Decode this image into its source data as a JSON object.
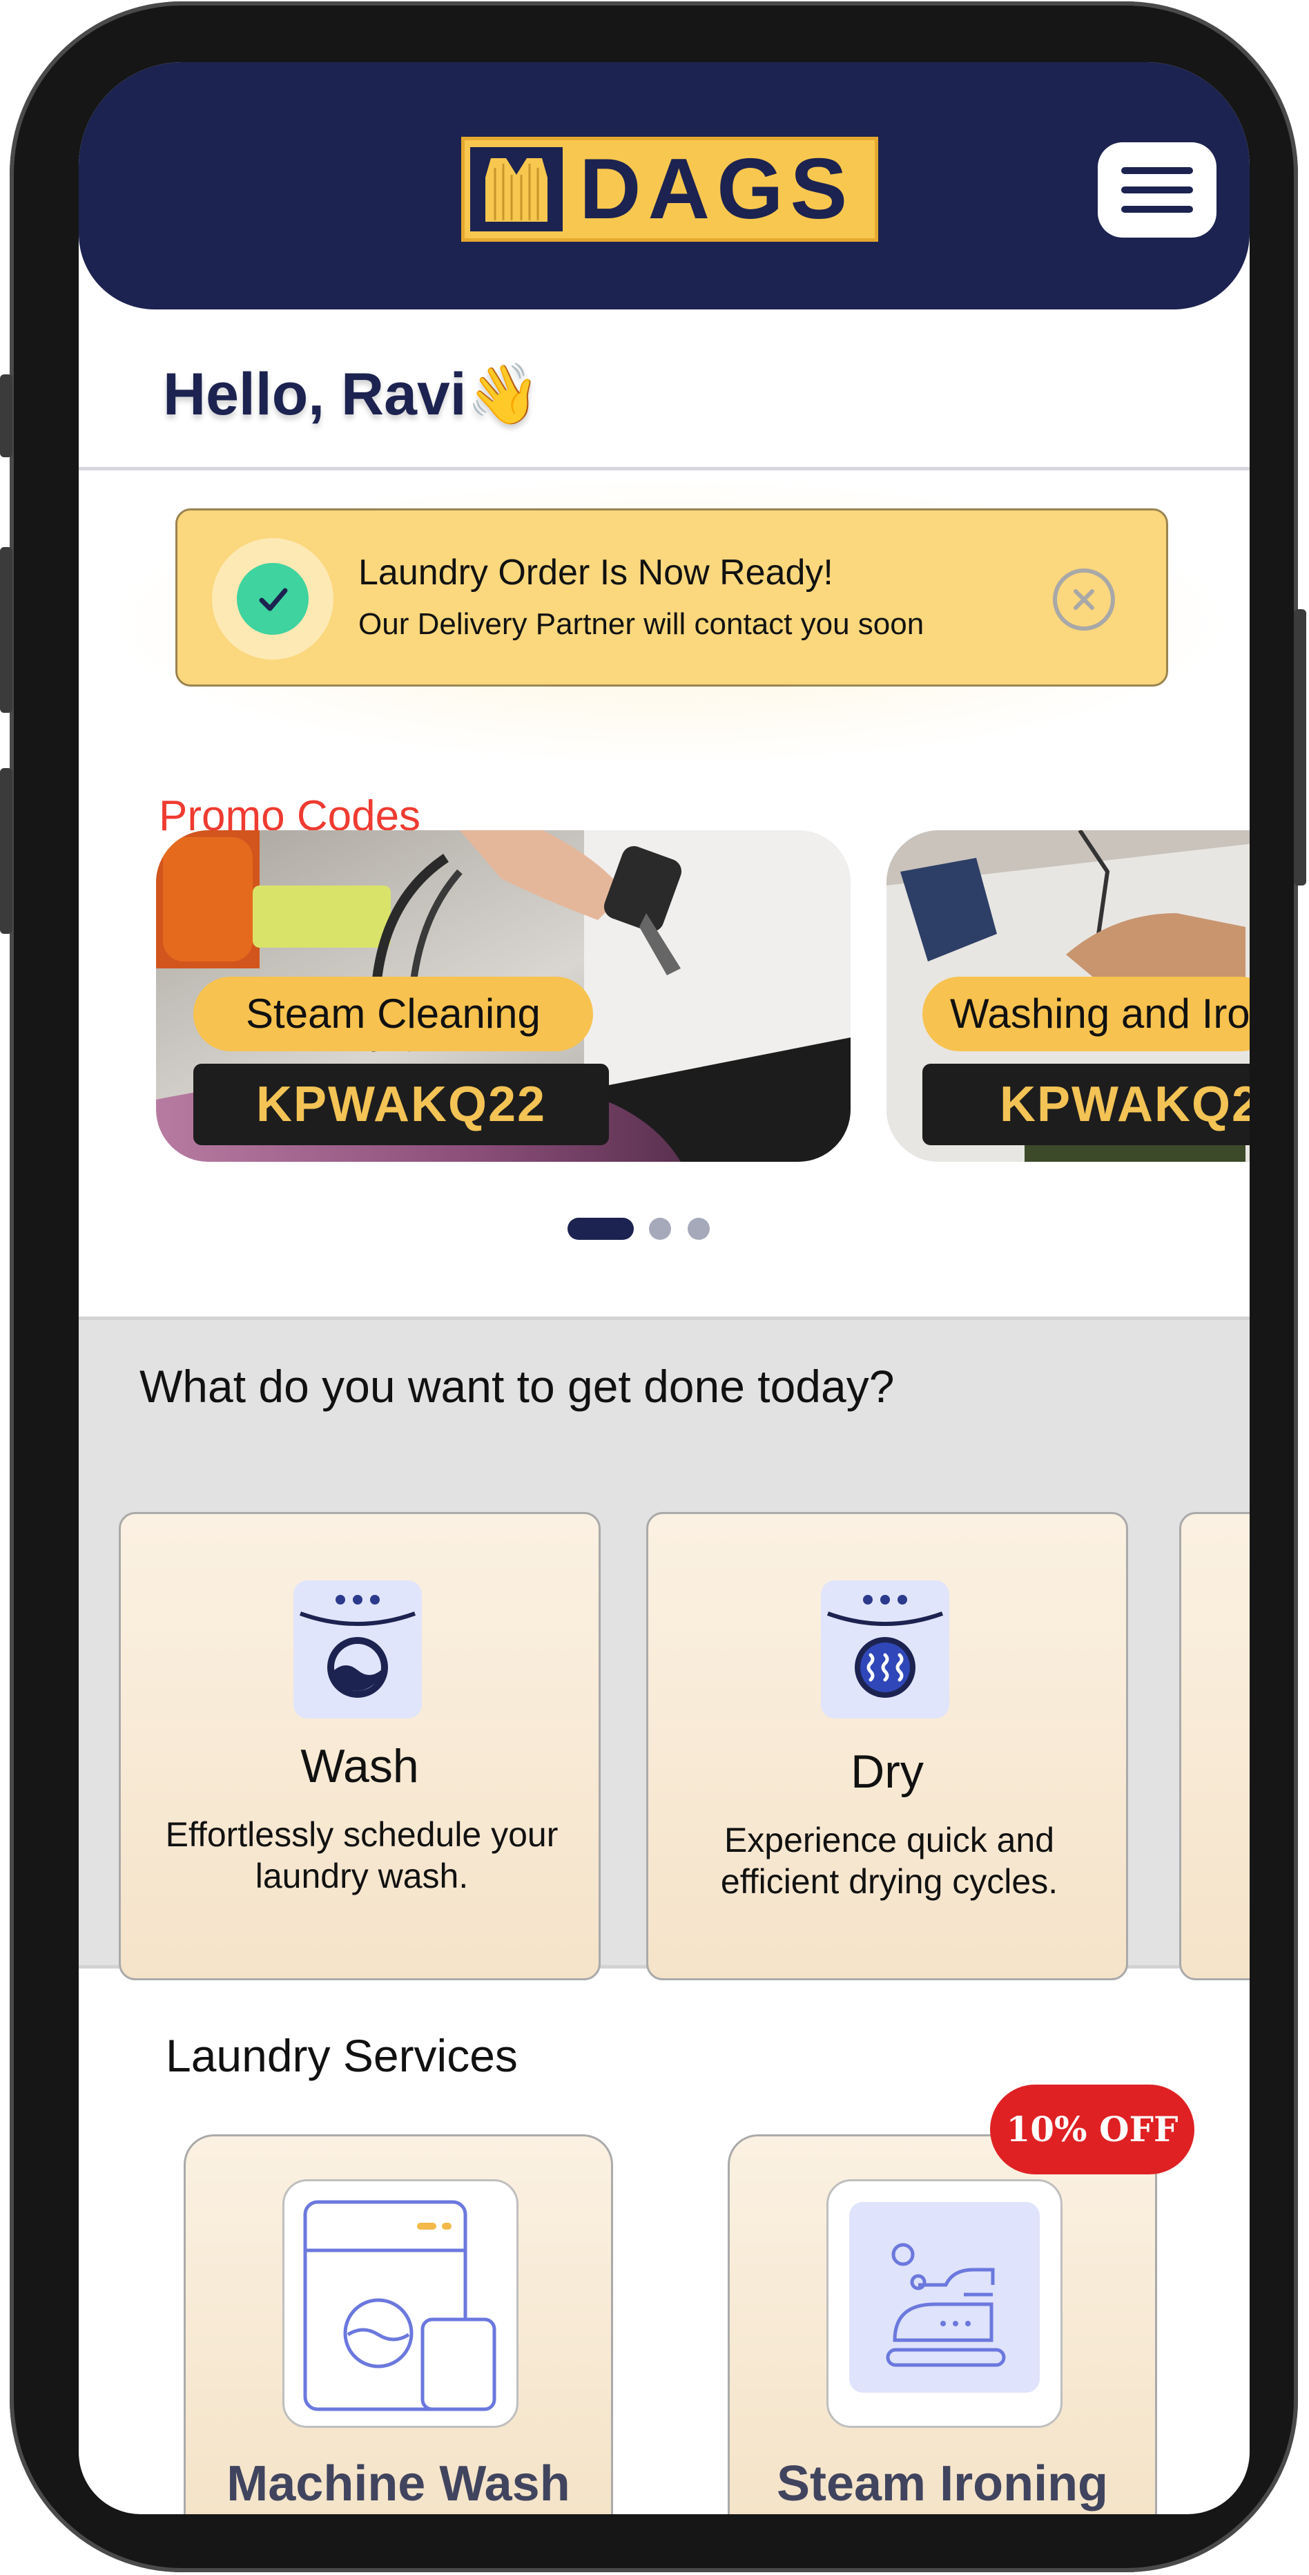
{
  "header": {
    "logo_text": "DAGS",
    "menu_icon": "hamburger-menu-icon"
  },
  "greeting": {
    "text": "Hello, Ravi",
    "emoji": "👋"
  },
  "notification": {
    "title": "Laundry Order Is Now Ready!",
    "subtitle": "Our Delivery Partner will contact you soon",
    "status_icon": "check-icon",
    "close_icon": "close-circle-icon"
  },
  "promo": {
    "section_title": "Promo Codes",
    "cards": [
      {
        "label": "Steam Cleaning",
        "code": "KPWAKQ22"
      },
      {
        "label": "Washing and Iro",
        "code": "KPWAKQ2"
      }
    ],
    "carousel_pages": 3,
    "active_page": 1
  },
  "services_question": {
    "title": "What do you want to get done today?",
    "items": [
      {
        "title": "Wash",
        "desc": "Effortlessly schedule your laundry wash.",
        "icon": "washing-machine-icon"
      },
      {
        "title": "Dry",
        "desc": "Experience quick and efficient drying cycles.",
        "icon": "dryer-icon"
      }
    ]
  },
  "laundry_services": {
    "title": "Laundry Services",
    "items": [
      {
        "name": "Machine Wash",
        "icon": "machine-wash-icon"
      },
      {
        "name": "Steam Ironing",
        "icon": "steam-iron-icon",
        "badge": "10% OFF"
      }
    ]
  },
  "colors": {
    "navy": "#1c2350",
    "yellow": "#f8c74f",
    "promo_red": "#ef3b31",
    "badge_red": "#df2124",
    "success_green": "#3ed39f"
  }
}
